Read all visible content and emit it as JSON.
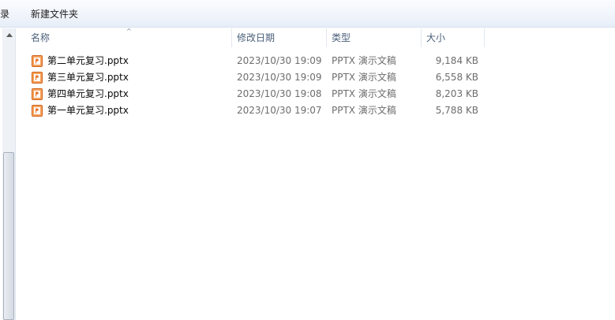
{
  "toolbar": {
    "left_label": "录",
    "new_folder_label": "新建文件夹"
  },
  "columns": {
    "name": "名称",
    "date": "修改日期",
    "type": "类型",
    "size": "大小"
  },
  "files": [
    {
      "name": "第二单元复习.pptx",
      "date": "2023/10/30 19:09",
      "type": "PPTX 演示文稿",
      "size": "9,184 KB",
      "icon": "pptx-file-icon"
    },
    {
      "name": "第三单元复习.pptx",
      "date": "2023/10/30 19:09",
      "type": "PPTX 演示文稿",
      "size": "6,558 KB",
      "icon": "pptx-file-icon"
    },
    {
      "name": "第四单元复习.pptx",
      "date": "2023/10/30 19:08",
      "type": "PPTX 演示文稿",
      "size": "8,203 KB",
      "icon": "pptx-file-icon"
    },
    {
      "name": "第一单元复习.pptx",
      "date": "2023/10/30 19:07",
      "type": "PPTX 演示文稿",
      "size": "5,788 KB",
      "icon": "pptx-file-icon"
    }
  ],
  "colors": {
    "pptx_icon_orange": "#e8772e",
    "header_text": "#4c607a",
    "detail_text": "#6d6d6d"
  }
}
